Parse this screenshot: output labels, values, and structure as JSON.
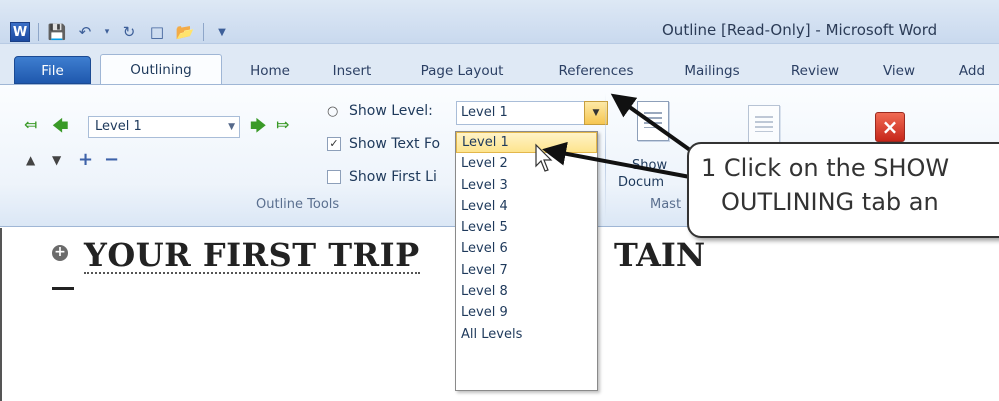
{
  "app": {
    "app_icon_letter": "W",
    "title": "Outline [Read-Only] - Microsoft Word"
  },
  "tabs": [
    {
      "label": "File"
    },
    {
      "label": "Outlining"
    },
    {
      "label": "Home"
    },
    {
      "label": "Insert"
    },
    {
      "label": "Page Layout"
    },
    {
      "label": "References"
    },
    {
      "label": "Mailings"
    },
    {
      "label": "Review"
    },
    {
      "label": "View"
    },
    {
      "label": "Add"
    }
  ],
  "outline_tools": {
    "level_value": "Level 1",
    "show_level_label": "Show Level:",
    "show_level_value": "Level 1",
    "show_text_formatting_label": "Show Text Fo",
    "show_text_formatting_checked": true,
    "show_first_line_label": "Show First Li",
    "show_first_line_checked": false,
    "group_label": "Outline Tools"
  },
  "master": {
    "show_document_label_1": "Show",
    "show_document_label_2": "Docum",
    "group_label": "Mast"
  },
  "dropdown_items": [
    "Level 1",
    "Level 2",
    "Level 3",
    "Level 4",
    "Level 5",
    "Level 6",
    "Level 7",
    "Level 8",
    "Level 9",
    "All Levels"
  ],
  "document": {
    "heading_text": "YOUR FIRST TRIP",
    "heading_tail": "TAIN"
  },
  "callout": {
    "line1": "1  Click on the SHOW",
    "line2": "OUTLINING tab an"
  },
  "colors": {
    "file_tab": "#2a63b8",
    "close_outline": "#d9331f",
    "selected_item": "#fde48d"
  }
}
